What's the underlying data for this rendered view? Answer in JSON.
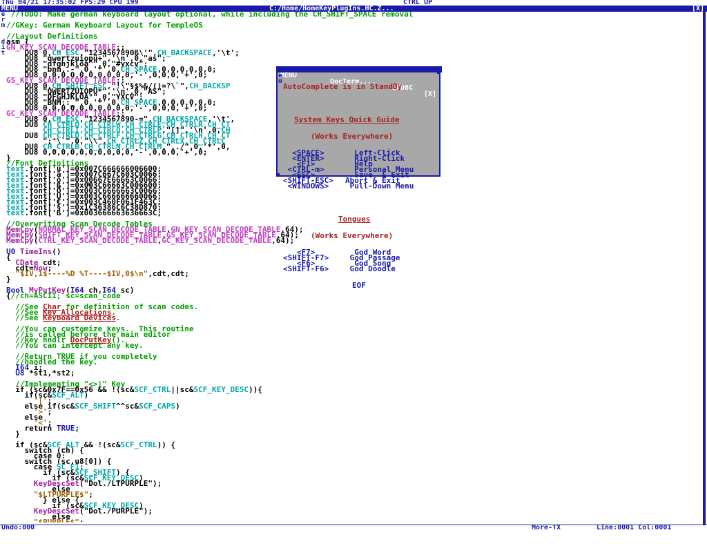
{
  "top": {
    "clock": "Thu 04/21 17:35:02 FPS:29 CPU 199",
    "ctrl": "CTRL UP"
  },
  "titlebar": {
    "menu": "MENU",
    "path": "C:/Home/HomeKeyPlugIns.HC.Z...",
    "close": "[X]"
  },
  "side_menu": [
    "e",
    "r",
    "m"
  ],
  "side_menu2": [
    "d",
    "i",
    "t"
  ],
  "code_lines": [
    [
      {
        "t": " ",
        "c": "c-black"
      },
      {
        "t": "//TODO: Make german keyboard layout optional, while including the CH_SHIFT_SPACE removal",
        "c": "c-green"
      }
    ],
    [
      {
        "t": "",
        "c": "c-black"
      }
    ],
    [
      {
        "t": "//GKey: German Keyboard Layout for TempleOS",
        "c": "c-green"
      }
    ],
    [
      {
        "t": "",
        "c": "c-black"
      }
    ],
    [
      {
        "t": "//Layout Definitions",
        "c": "c-green"
      }
    ],
    [
      {
        "t": "asm {",
        "c": "c-black"
      }
    ],
    [
      {
        "t": "GN_KEY_SCAN_DECODE_TABLE",
        "c": "c-magenta"
      },
      {
        "t": "::",
        "c": "c-black"
      }
    ],
    [
      {
        "t": "    DU8 0,",
        "c": "c-black"
      },
      {
        "t": "CH_ESC",
        "c": "c-cyan"
      },
      {
        "t": ",\"1234567890ß\\'\",",
        "c": "c-black"
      },
      {
        "t": "CH_BACKSPACE",
        "c": "c-cyan"
      },
      {
        "t": ",'\\t';",
        "c": "c-black"
      }
    ],
    [
      {
        "t": "    DU8 \"qwertzuiopü+\",'\\n',0,\"as\";",
        "c": "c-black"
      }
    ],
    [
      {
        "t": "    DU8 \"dfghjklöä^\",0,\"#yxcv\";",
        "c": "c-black"
      }
    ],
    [
      {
        "t": "    DU8 \"bnm,.-\",0,'*',0,",
        "c": "c-black"
      },
      {
        "t": "CH_SPACE",
        "c": "c-cyan"
      },
      {
        "t": ",0,0,0,0,0,0;",
        "c": "c-black"
      }
    ],
    [
      {
        "t": "    DU8 0,0,0,0,0,0,0,0,0,0,'-',0,0,0,'+',0;",
        "c": "c-black"
      }
    ],
    [
      {
        "t": "GS_KEY_SCAN_DECODE_TABLE",
        "c": "c-magenta"
      },
      {
        "t": "::",
        "c": "c-black"
      }
    ],
    [
      {
        "t": "    DU8 0,",
        "c": "c-black"
      },
      {
        "t": "CH_SHIFT_ESC",
        "c": "c-cyan"
      },
      {
        "t": ",\"!\\\"§$%&/()=?\\`\",",
        "c": "c-black"
      },
      {
        "t": "CH_BACKSP",
        "c": "c-cyan"
      }
    ],
    [
      {
        "t": "    DU8 \"QWERTZUIOPÜ*\",'\\n',0,\"AS\";",
        "c": "c-black"
      }
    ],
    [
      {
        "t": "    DU8 \"DFGHJKLÖÄ°\",0,\"YXCV\";",
        "c": "c-black"
      }
    ],
    [
      {
        "t": "    DU8 \"BNM;:_\",0,'*',0,",
        "c": "c-black"
      },
      {
        "t": "CH_SPACE",
        "c": "c-cyan"
      },
      {
        "t": ",0,0,0,0,0,0;",
        "c": "c-black"
      }
    ],
    [
      {
        "t": "    DU8 0,0,0,0,0,0,0,0,0,0,'-',0,0,0,'+',0;",
        "c": "c-black"
      }
    ],
    [
      {
        "t": "GC_KEY_SCAN_DECODE_TABLE",
        "c": "c-magenta"
      },
      {
        "t": "::",
        "c": "c-black"
      }
    ],
    [
      {
        "t": "    DU8 0,",
        "c": "c-black"
      },
      {
        "t": "CH_ESC",
        "c": "c-cyan"
      },
      {
        "t": ",\"1234567890-=\",",
        "c": "c-black"
      },
      {
        "t": "CH_BACKSPACE",
        "c": "c-cyan"
      },
      {
        "t": ",'\\t',",
        "c": "c-black"
      }
    ],
    [
      {
        "t": "    DU8 ",
        "c": "c-black"
      },
      {
        "t": "CH_CTRLQ,CH_CTRLW,CH_CTRLE,CH_CTRLR,CH_CT",
        "c": "c-cyan"
      }
    ],
    [
      {
        "t": "        ",
        "c": "c-black"
      },
      {
        "t": "CH_CTRLI,CH_CTRLO,CH_CTRLP",
        "c": "c-cyan"
      },
      {
        "t": ",\"[]\",'\\n',0,",
        "c": "c-black"
      },
      {
        "t": "CH",
        "c": "c-cyan"
      }
    ],
    [
      {
        "t": "    DU8 ",
        "c": "c-black"
      },
      {
        "t": "CH_CTRLD,CH_CTRLF,CH_CTRLG,CH_CTRLH,CH_CT",
        "c": "c-cyan"
      }
    ],
    [
      {
        "t": "        \";'\\`\",0,\"\\\\\",",
        "c": "c-black"
      },
      {
        "t": "CH_CTRLZ,CH_CTRLX,CH_CTRLC",
        "c": "c-cyan"
      }
    ],
    [
      {
        "t": "    DU8 ",
        "c": "c-black"
      },
      {
        "t": "CH_CTRLB,CH_CTRLN,CH_CTRLM",
        "c": "c-cyan"
      },
      {
        "t": ",\",./\",0,'*',0,",
        "c": "c-black"
      }
    ],
    [
      {
        "t": "    DU8 0,0,0,0,0,0,0,0,0,0,'-',0,0,0,'+',0;",
        "c": "c-black"
      }
    ],
    [
      {
        "t": "}",
        "c": "c-black"
      }
    ],
    [
      {
        "t": "//Font Definitions",
        "c": "c-green"
      }
    ],
    [
      {
        "t": "text",
        "c": "c-cyan"
      },
      {
        "t": ".font['ü']=0x007C666666006600;",
        "c": "c-black"
      }
    ],
    [
      {
        "t": "text",
        "c": "c-cyan"
      },
      {
        "t": ".font['ä']=0x007C667C603C0066;",
        "c": "c-black"
      }
    ],
    [
      {
        "t": "text",
        "c": "c-cyan"
      },
      {
        "t": ".font['ö']=0x00667E66663C0066;",
        "c": "c-black"
      }
    ],
    [
      {
        "t": "text",
        "c": "c-cyan"
      },
      {
        "t": ".font['ß']=0x003C66663C006600;",
        "c": "c-black"
      }
    ],
    [
      {
        "t": "text",
        "c": "c-cyan"
      },
      {
        "t": ".font['Ö']=0x003C6666663C0066;",
        "c": "c-black"
      }
    ],
    [
      {
        "t": "text",
        "c": "c-cyan"
      },
      {
        "t": ".font['Ü']=0x003C666666660066;",
        "c": "c-black"
      }
    ],
    [
      {
        "t": "text",
        "c": "c-cyan"
      },
      {
        "t": ".font['€']=0x003C460F061F463C;",
        "c": "c-black"
      }
    ],
    [
      {
        "t": "text",
        "c": "c-cyan"
      },
      {
        "t": ".font['§']=0x1C36386C6C38D870;",
        "c": "c-black"
      }
    ],
    [
      {
        "t": "text",
        "c": "c-cyan"
      },
      {
        "t": ".font['ß']=0x003666663636663C;",
        "c": "c-black"
      }
    ],
    [
      {
        "t": "",
        "c": "c-black"
      }
    ],
    [
      {
        "t": "//Overwriting Scan Decode Tables",
        "c": "c-green"
      }
    ],
    [
      {
        "t": "MemCpy",
        "c": "c-purple"
      },
      {
        "t": "(",
        "c": "c-black"
      },
      {
        "t": "NORMAL_KEY_SCAN_DECODE_TABLE",
        "c": "c-magenta"
      },
      {
        "t": ",",
        "c": "c-black"
      },
      {
        "t": "GN_KEY_SCAN_DECODE_TABLE",
        "c": "c-magenta"
      },
      {
        "t": ",64);",
        "c": "c-black"
      }
    ],
    [
      {
        "t": "MemCpy",
        "c": "c-purple"
      },
      {
        "t": "(",
        "c": "c-black"
      },
      {
        "t": "SHIFT_KEY_SCAN_DECODE_TABLE",
        "c": "c-magenta"
      },
      {
        "t": ",",
        "c": "c-black"
      },
      {
        "t": "GS_KEY_SCAN_DECODE_TABLE",
        "c": "c-magenta"
      },
      {
        "t": ",64);",
        "c": "c-black"
      }
    ],
    [
      {
        "t": "MemCpy",
        "c": "c-purple"
      },
      {
        "t": "(",
        "c": "c-black"
      },
      {
        "t": "CTRL_KEY_SCAN_DECODE_TABLE",
        "c": "c-magenta"
      },
      {
        "t": ",",
        "c": "c-black"
      },
      {
        "t": "GC_KEY_SCAN_DECODE_TABLE",
        "c": "c-magenta"
      },
      {
        "t": ",64);",
        "c": "c-black"
      }
    ],
    [
      {
        "t": "",
        "c": "c-black"
      }
    ],
    [
      {
        "t": "U0 ",
        "c": "c-blue"
      },
      {
        "t": "TimeIns",
        "c": "c-purple"
      },
      {
        "t": "()",
        "c": "c-black"
      }
    ],
    [
      {
        "t": "{",
        "c": "c-black"
      }
    ],
    [
      {
        "t": "  ",
        "c": "c-black"
      },
      {
        "t": "CDate",
        "c": "c-purple"
      },
      {
        "t": " cdt;",
        "c": "c-black"
      }
    ],
    [
      {
        "t": "  cdt=",
        "c": "c-black"
      },
      {
        "t": "Now",
        "c": "c-purple"
      },
      {
        "t": ";",
        "c": "c-black"
      }
    ],
    [
      {
        "t": "  ",
        "c": "c-black"
      },
      {
        "t": "\"$IV,1$----%D %T----$IV,0$\\n\"",
        "c": "c-brown"
      },
      {
        "t": ",cdt,cdt;",
        "c": "c-black"
      }
    ],
    [
      {
        "t": "}",
        "c": "c-black"
      }
    ],
    [
      {
        "t": "",
        "c": "c-black"
      }
    ],
    [
      {
        "t": "Bool ",
        "c": "c-blue"
      },
      {
        "t": "MyPutKey",
        "c": "c-purple"
      },
      {
        "t": "(",
        "c": "c-black"
      },
      {
        "t": "I64",
        "c": "c-blue"
      },
      {
        "t": " ch,",
        "c": "c-black"
      },
      {
        "t": "I64",
        "c": "c-blue"
      },
      {
        "t": " sc)",
        "c": "c-black"
      }
    ],
    [
      {
        "t": "{",
        "c": "c-black"
      },
      {
        "t": "//ch=ASCII; sc=scan_code",
        "c": "c-green"
      }
    ],
    [
      {
        "t": "",
        "c": "c-black"
      }
    ],
    [
      {
        "t": "  //See ",
        "c": "c-green"
      },
      {
        "t": "Char",
        "c": "c-red"
      },
      {
        "t": " for definition of scan codes.",
        "c": "c-green"
      }
    ],
    [
      {
        "t": "  //See ",
        "c": "c-green"
      },
      {
        "t": "Key Allocations",
        "c": "c-red"
      },
      {
        "t": ".",
        "c": "c-green"
      }
    ],
    [
      {
        "t": "  //See ",
        "c": "c-green"
      },
      {
        "t": "Keyboard Devices",
        "c": "c-red"
      },
      {
        "t": ".",
        "c": "c-green"
      }
    ],
    [
      {
        "t": "",
        "c": "c-black"
      }
    ],
    [
      {
        "t": "  //You can customize keys.  This routine",
        "c": "c-green"
      }
    ],
    [
      {
        "t": "  //is called before the main editor",
        "c": "c-green"
      }
    ],
    [
      {
        "t": "  //key hndlr ",
        "c": "c-green"
      },
      {
        "t": "DocPutKey",
        "c": "c-red"
      },
      {
        "t": "().",
        "c": "c-green"
      }
    ],
    [
      {
        "t": "  //You can intercept any key.",
        "c": "c-green"
      }
    ],
    [
      {
        "t": "",
        "c": "c-black"
      }
    ],
    [
      {
        "t": "  //Return TRUE if you completely",
        "c": "c-green"
      }
    ],
    [
      {
        "t": "  //handled the key.",
        "c": "c-green"
      }
    ],
    [
      {
        "t": "  ",
        "c": "c-black"
      },
      {
        "t": "I64",
        "c": "c-blue"
      },
      {
        "t": " i;",
        "c": "c-black"
      }
    ],
    [
      {
        "t": "  ",
        "c": "c-black"
      },
      {
        "t": "U8",
        "c": "c-blue"
      },
      {
        "t": " *st1,*st2;",
        "c": "c-black"
      }
    ],
    [
      {
        "t": "",
        "c": "c-black"
      }
    ],
    [
      {
        "t": "  //Implementing \"<>|\" Key",
        "c": "c-green"
      }
    ],
    [
      {
        "t": "  if (sc&0x7F==0x56 && !(sc&",
        "c": "c-black"
      },
      {
        "t": "SCF_CTRL",
        "c": "c-cyan"
      },
      {
        "t": "||sc&",
        "c": "c-black"
      },
      {
        "t": "SCF_KEY_DESC",
        "c": "c-cyan"
      },
      {
        "t": ")){",
        "c": "c-black"
      }
    ],
    [
      {
        "t": "    if(sc&",
        "c": "c-black"
      },
      {
        "t": "SCF_ALT",
        "c": "c-cyan"
      },
      {
        "t": ")",
        "c": "c-black"
      }
    ],
    [
      {
        "t": "      ",
        "c": "c-black"
      },
      {
        "t": "'|'",
        "c": "c-brown"
      },
      {
        "t": ";",
        "c": "c-black"
      }
    ],
    [
      {
        "t": "    else if(sc&",
        "c": "c-black"
      },
      {
        "t": "SCF_SHIFT",
        "c": "c-cyan"
      },
      {
        "t": "^^sc&",
        "c": "c-black"
      },
      {
        "t": "SCF_CAPS",
        "c": "c-cyan"
      },
      {
        "t": ")",
        "c": "c-black"
      }
    ],
    [
      {
        "t": "      ",
        "c": "c-black"
      },
      {
        "t": "'>'",
        "c": "c-brown"
      },
      {
        "t": ";",
        "c": "c-black"
      }
    ],
    [
      {
        "t": "    else",
        "c": "c-black"
      }
    ],
    [
      {
        "t": "      ",
        "c": "c-black"
      },
      {
        "t": "'<'",
        "c": "c-brown"
      },
      {
        "t": ";",
        "c": "c-black"
      }
    ],
    [
      {
        "t": "    return ",
        "c": "c-black"
      },
      {
        "t": "TRUE",
        "c": "c-blue"
      },
      {
        "t": ";",
        "c": "c-black"
      }
    ],
    [
      {
        "t": "  }",
        "c": "c-black"
      }
    ],
    [
      {
        "t": "",
        "c": "c-black"
      }
    ],
    [
      {
        "t": "  if (sc&",
        "c": "c-black"
      },
      {
        "t": "SCF_ALT",
        "c": "c-cyan"
      },
      {
        "t": " && !(sc&",
        "c": "c-black"
      },
      {
        "t": "SCF_CTRL",
        "c": "c-cyan"
      },
      {
        "t": ")) {",
        "c": "c-black"
      }
    ],
    [
      {
        "t": "    switch (ch) {",
        "c": "c-black"
      }
    ],
    [
      {
        "t": "      case 0:",
        "c": "c-black"
      }
    ],
    [
      {
        "t": "    switch (sc.u8[0]) {",
        "c": "c-black"
      }
    ],
    [
      {
        "t": "      case ",
        "c": "c-black"
      },
      {
        "t": "SC_F1",
        "c": "c-cyan"
      },
      {
        "t": ":",
        "c": "c-black"
      }
    ],
    [
      {
        "t": "        if (sc&",
        "c": "c-black"
      },
      {
        "t": "SCF_SHIFT",
        "c": "c-cyan"
      },
      {
        "t": ") {",
        "c": "c-black"
      }
    ],
    [
      {
        "t": "          if (sc&",
        "c": "c-black"
      },
      {
        "t": "SCF_KEY_DESC",
        "c": "c-cyan"
      },
      {
        "t": ")",
        "c": "c-black"
      }
    ],
    [
      {
        "t": "      ",
        "c": "c-black"
      },
      {
        "t": "KeyDescSet",
        "c": "c-purple"
      },
      {
        "t": "(\"Dol./LTPURPLE\");",
        "c": "c-black"
      }
    ],
    [
      {
        "t": "          else",
        "c": "c-black"
      }
    ],
    [
      {
        "t": "      ",
        "c": "c-black"
      },
      {
        "t": "\"$LTPURPLE$\"",
        "c": "c-brown"
      },
      {
        "t": ";",
        "c": "c-black"
      }
    ],
    [
      {
        "t": "        } else {",
        "c": "c-black"
      }
    ],
    [
      {
        "t": "          if (sc&",
        "c": "c-black"
      },
      {
        "t": "SCF_KEY_DESC",
        "c": "c-cyan"
      },
      {
        "t": ")",
        "c": "c-black"
      }
    ],
    [
      {
        "t": "      ",
        "c": "c-black"
      },
      {
        "t": "KeyDescSet",
        "c": "c-purple"
      },
      {
        "t": "(\"Dol./PURPLE\");",
        "c": "c-black"
      }
    ],
    [
      {
        "t": "          else",
        "c": "c-black"
      }
    ],
    [
      {
        "t": "      ",
        "c": "c-black"
      },
      {
        "t": "\"$PURPLE$\"",
        "c": "c-brown"
      },
      {
        "t": ";",
        "c": "c-black"
      }
    ]
  ],
  "popup": {
    "title_menu": "MENU",
    "title_name": "DocTerm....",
    "title_addr": "3FD8C",
    "title_close": "[X]",
    "side": [
      "e",
      "m"
    ],
    "status": "AutoComplete is in StandBy",
    "heading1": "System Keys Quick Guide",
    "heading1b": "(Works Everywhere)",
    "keys": [
      {
        "k": "  <SPACE>",
        "v": "  Left-Click"
      },
      {
        "k": "  <ENTER>",
        "v": "  Right-Click"
      },
      {
        "k": "   <F1>  ",
        "v": "  Help"
      },
      {
        "k": " <CTRL-m>",
        "v": "  Personal Menu"
      },
      {
        "k": "  <ESC>  ",
        "v": "  Save  & Exit"
      },
      {
        "k": "<SHIFT-ESC>",
        "v": "Abort & Exit"
      },
      {
        "k": " <WINDOWS>",
        "v": " Pull-Down Menu"
      }
    ],
    "heading2": "Tongues",
    "heading2b": "(Works Everywhere)",
    "tongues": [
      {
        "k": "   <F7>  ",
        "v": "  God Word"
      },
      {
        "k": "<SHIFT-F7>",
        "v": " God Passage"
      },
      {
        "k": "   <F6>  ",
        "v": "  God Song"
      },
      {
        "k": "<SHIFT-F6>",
        "v": " God Doodle"
      }
    ],
    "eof": "EOF"
  },
  "status": {
    "undo": "Undo:000",
    "mode": "More-TX",
    "position": "Line:0001 Col:0001"
  }
}
